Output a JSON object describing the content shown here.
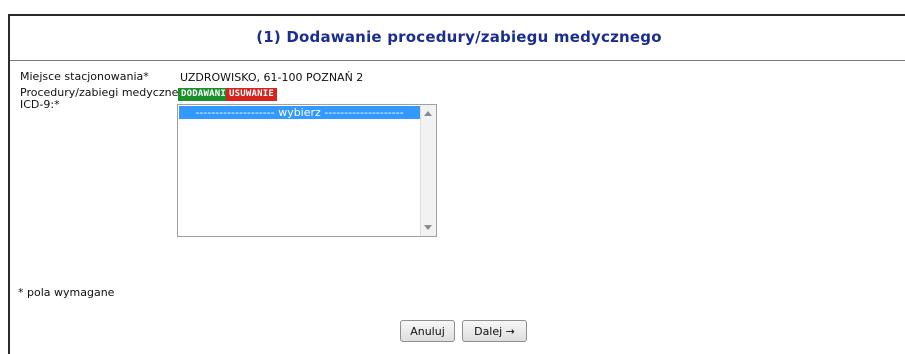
{
  "form": {
    "title": "(1) Dodawanie procedury/zabiegu medycznego",
    "location_label": "Miejsce stacjonowania*",
    "location_value": "UZDROWISKO, 61-100 POZNAŃ 2",
    "procedures_label_line1": "Procedury/zabiegi medyczne",
    "procedures_label_line2": "ICD-9:*",
    "add_tag": "DODAWANIE",
    "remove_tag": "USUWANIE",
    "list_option_selected": "-------------------- wybierz --------------------",
    "required_note": "* pola wymagane"
  },
  "buttons": {
    "cancel": "Anuluj",
    "next": "Dalej →"
  },
  "colors": {
    "title": "#1b2e8f",
    "add_tag_bg": "#1b8f2a",
    "remove_tag_bg": "#d6231e",
    "selected_option_bg": "#3399ff"
  }
}
